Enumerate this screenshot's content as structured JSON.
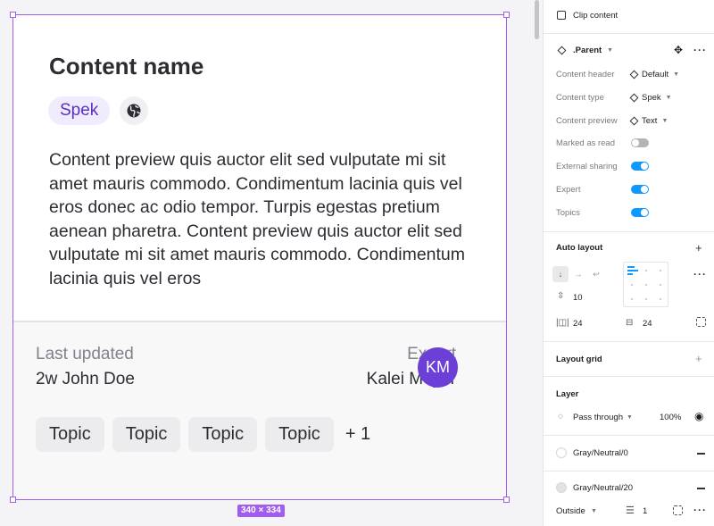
{
  "card": {
    "title": "Content name",
    "type_label": "Spek",
    "globe_icon": "globe-icon",
    "preview_text": "Content preview quis auctor elit sed vulputate mi sit amet mauris commodo. Condimentum lacinia quis vel eros donec ac odio tempor. Turpis egestas pretium aenean pharetra. Content preview quis auctor elit sed vulputate mi sit amet mauris commodo. Condimentum lacinia quis vel eros",
    "last_updated_label": "Last updated",
    "last_updated_value": "2w John Doe",
    "expert_label": "Expert",
    "expert_name": "Kalei Meyer",
    "avatar_initials": "KM",
    "topics": [
      "Topic",
      "Topic",
      "Topic",
      "Topic"
    ],
    "topics_more": "+ 1",
    "size_badge": "340 × 334"
  },
  "panel": {
    "clip_content_label": "Clip content",
    "component_name": ".Parent",
    "props": [
      {
        "label": "Content header",
        "value": "Default"
      },
      {
        "label": "Content type",
        "value": "Spek"
      },
      {
        "label": "Content preview",
        "value": "Text"
      }
    ],
    "toggles": [
      {
        "label": "Marked as read",
        "on": false
      },
      {
        "label": "External sharing",
        "on": true
      },
      {
        "label": "Expert",
        "on": true
      },
      {
        "label": "Topics",
        "on": true
      }
    ],
    "auto_layout": {
      "title": "Auto layout",
      "gap": "10",
      "padding_horizontal": "24",
      "padding_vertical": "24"
    },
    "layout_grid_title": "Layout grid",
    "layer": {
      "title": "Layer",
      "blend_mode": "Pass through",
      "opacity": "100%"
    },
    "fills": [
      {
        "name": "Gray/Neutral/0",
        "color": "#ffffff"
      },
      {
        "name": "Gray/Neutral/20",
        "color": "#e2e3e7"
      }
    ],
    "stroke": {
      "position": "Outside",
      "weight": "1"
    }
  },
  "colors": {
    "accent": "#a35cf0",
    "avatar": "#6c3fd7",
    "toggle_on": "#0d99ff",
    "type_pill_text": "#5b2fc9"
  }
}
